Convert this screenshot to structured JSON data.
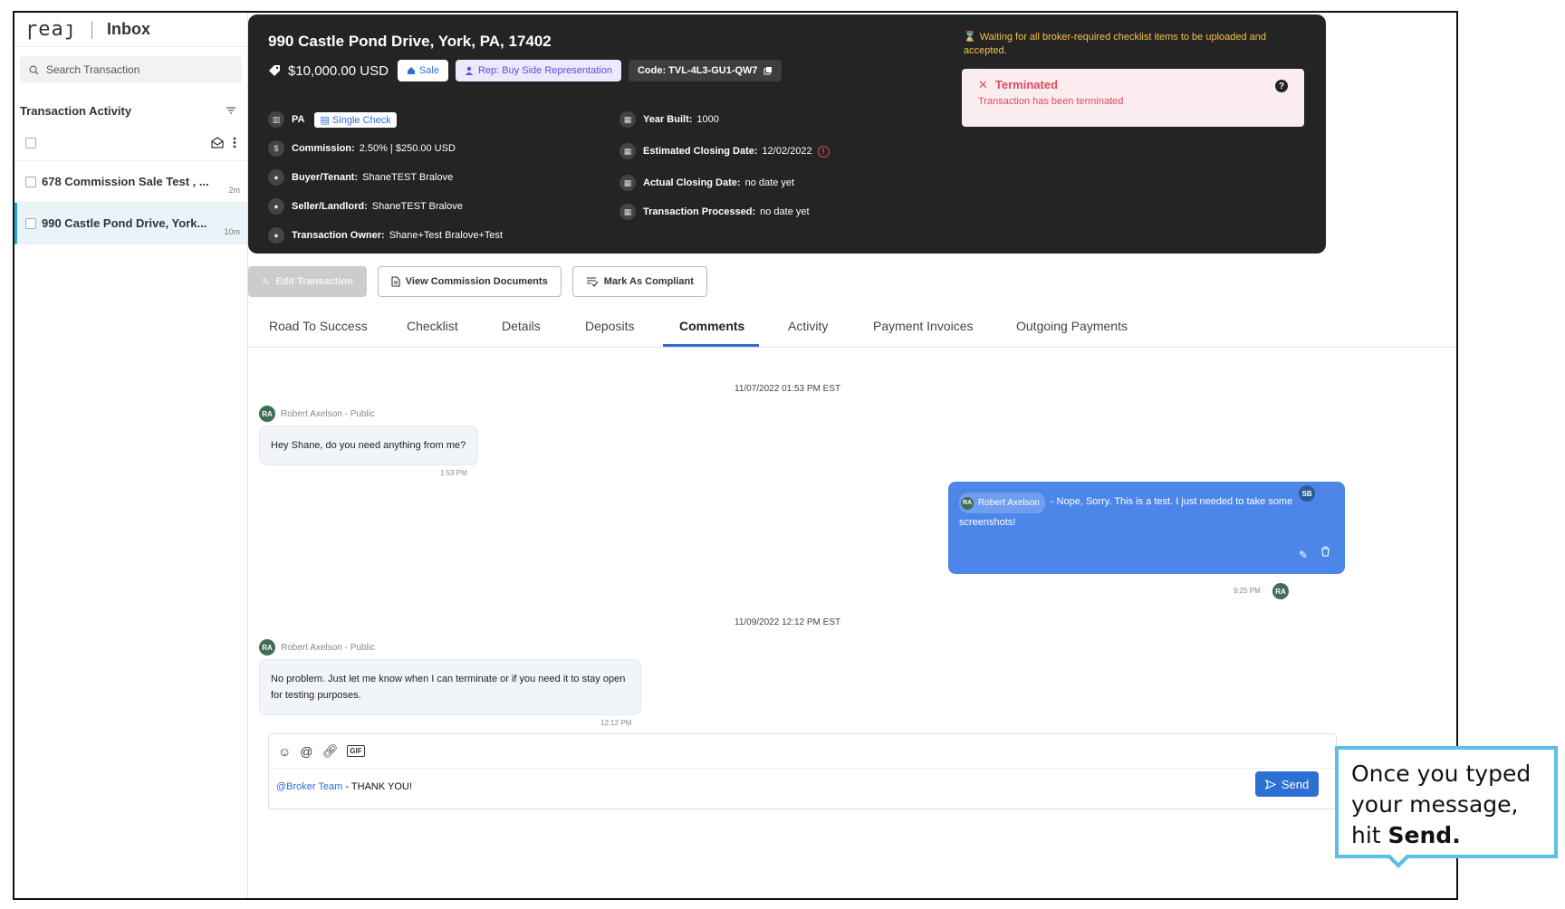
{
  "sidebar": {
    "logo": "ɼeaȷ",
    "title": "Inbox",
    "search_placeholder": "Search Transaction",
    "activity_title": "Transaction Activity",
    "items": [
      {
        "label": "678 Commission Sale Test , ...",
        "time": "2m",
        "active": false
      },
      {
        "label": "990 Castle Pond Drive, York...",
        "time": "10m",
        "active": true
      }
    ]
  },
  "header": {
    "address": "990 Castle Pond Drive, York, PA, 17402",
    "price": "$10,000.00 USD",
    "sale_label": "Sale",
    "rep_label": "Rep: Buy Side Representation",
    "code_label": "Code: TVL-4L3-GU1-QW7",
    "state": "PA",
    "single_check": "Single Check",
    "commission_label": "Commission:",
    "commission_value": "2.50% | $250.00 USD",
    "buyer_label": "Buyer/Tenant:",
    "buyer_value": "ShaneTEST Bralove",
    "seller_label": "Seller/Landlord:",
    "seller_value": "ShaneTEST Bralove",
    "owner_label": "Transaction Owner:",
    "owner_value": "Shane+Test Bralove+Test",
    "year_label": "Year Built:",
    "year_value": "1000",
    "est_label": "Estimated Closing Date:",
    "est_value": "12/02/2022",
    "actual_label": "Actual Closing Date:",
    "actual_value": "no date yet",
    "processed_label": "Transaction Processed:",
    "processed_value": "no date yet",
    "warning": "Waiting for all broker-required checklist items to be uploaded and accepted.",
    "terminated_title": "Terminated",
    "terminated_text": "Transaction has been terminated"
  },
  "actions": {
    "edit": "Edit Transaction",
    "view_docs": "View Commission Documents",
    "compliant": "Mark As Compliant"
  },
  "tabs": [
    "Road To Success",
    "Checklist",
    "Details",
    "Deposits",
    "Comments",
    "Activity",
    "Payment Invoices",
    "Outgoing Payments"
  ],
  "active_tab": "Comments",
  "comments": {
    "date1": "11/07/2022 01:53 PM EST",
    "c1_author": "Robert Axelson - Public",
    "c1_initials": "RA",
    "c1_text": "Hey Shane, do you need anything from me?",
    "c1_time": "1:53 PM",
    "reply_initials": "SB",
    "reply_mention": "Robert Axelson",
    "reply_mention_initials": "RA",
    "reply_text": "- Nope, Sorry. This is a test. I just needed to take some screenshots!",
    "reply_time": "9:25 PM",
    "reply_seen_initials": "RA",
    "date2": "11/09/2022 12:12 PM EST",
    "c2_author": "Robert Axelson - Public",
    "c2_initials": "RA",
    "c2_text": "No problem. Just let me know when I can terminate or if you need it to stay open for testing purposes.",
    "c2_time": "12:12 PM"
  },
  "composer": {
    "mention": "@Broker Team",
    "text": " - THANK YOU!",
    "send_label": "Send",
    "gif_label": "GIF"
  },
  "callout": {
    "text_before": "Once you typed your message, hit ",
    "text_bold": "Send."
  },
  "colors": {
    "accent": "#2e6fd6",
    "hero_bg": "#242424",
    "outgoing_bubble": "#4c86e8",
    "terminated": "#e04a5c",
    "warning": "#f4c04a",
    "callout_border": "#5bbfe6"
  }
}
